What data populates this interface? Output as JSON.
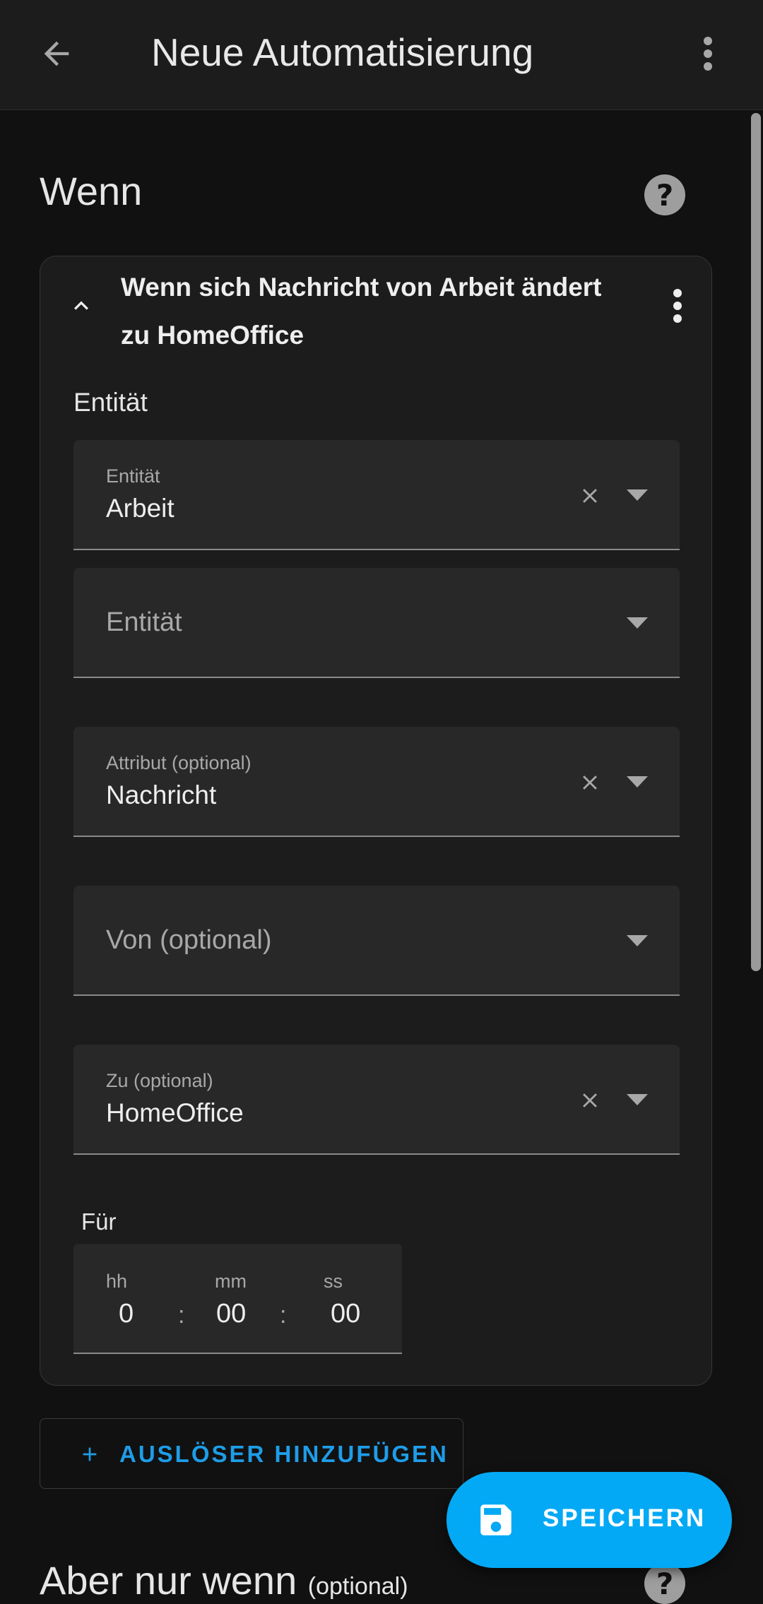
{
  "appbar": {
    "title": "Neue Automatisierung"
  },
  "when_section": {
    "title": "Wenn",
    "help": "?"
  },
  "trigger_card": {
    "title": "Wenn sich Nachricht von Arbeit ändert zu HomeOffice",
    "entity_section_label": "Entität",
    "fields": {
      "entity": {
        "label": "Entität",
        "value": "Arbeit"
      },
      "entity2": {
        "placeholder": "Entität"
      },
      "attribute": {
        "label": "Attribut (optional)",
        "value": "Nachricht"
      },
      "from": {
        "placeholder": "Von (optional)"
      },
      "to": {
        "label": "Zu (optional)",
        "value": "HomeOffice"
      }
    },
    "duration": {
      "label": "Für",
      "hours_label": "hh",
      "hours": "0",
      "minutes_label": "mm",
      "minutes": "00",
      "seconds_label": "ss",
      "seconds": "00",
      "separator": ":"
    }
  },
  "add_trigger": {
    "label": "AUSLÖSER HINZUFÜGEN"
  },
  "save_fab": {
    "label": "SPEICHERN"
  },
  "but_only_if": {
    "title": "Aber nur wenn",
    "optional": "(optional)",
    "help": "?"
  },
  "colors": {
    "background": "#111111",
    "card": "#1c1c1c",
    "field": "#282828",
    "accent": "#03a9f4",
    "link": "#1e9de8"
  }
}
